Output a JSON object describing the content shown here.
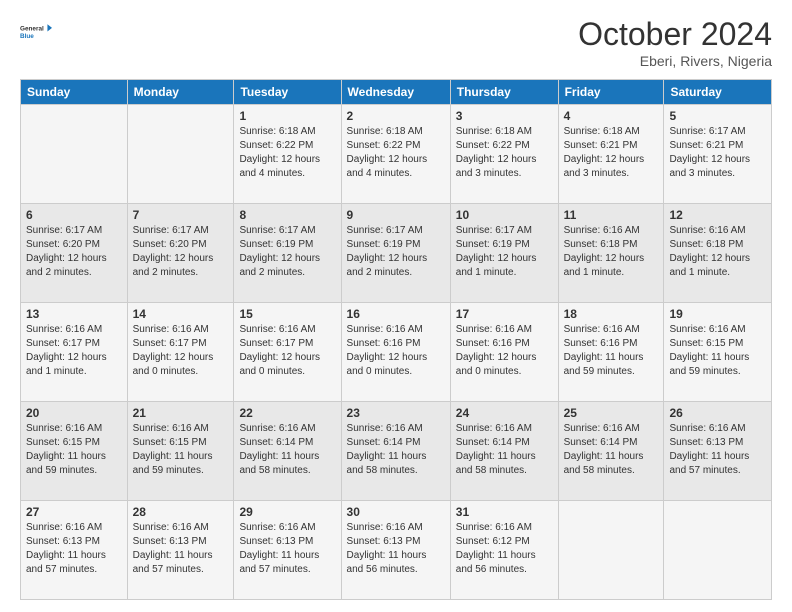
{
  "header": {
    "logo_line1": "General",
    "logo_line2": "Blue",
    "month": "October 2024",
    "location": "Eberi, Rivers, Nigeria"
  },
  "weekdays": [
    "Sunday",
    "Monday",
    "Tuesday",
    "Wednesday",
    "Thursday",
    "Friday",
    "Saturday"
  ],
  "weeks": [
    [
      {
        "day": "",
        "info": ""
      },
      {
        "day": "",
        "info": ""
      },
      {
        "day": "1",
        "info": "Sunrise: 6:18 AM\nSunset: 6:22 PM\nDaylight: 12 hours and 4 minutes."
      },
      {
        "day": "2",
        "info": "Sunrise: 6:18 AM\nSunset: 6:22 PM\nDaylight: 12 hours and 4 minutes."
      },
      {
        "day": "3",
        "info": "Sunrise: 6:18 AM\nSunset: 6:22 PM\nDaylight: 12 hours and 3 minutes."
      },
      {
        "day": "4",
        "info": "Sunrise: 6:18 AM\nSunset: 6:21 PM\nDaylight: 12 hours and 3 minutes."
      },
      {
        "day": "5",
        "info": "Sunrise: 6:17 AM\nSunset: 6:21 PM\nDaylight: 12 hours and 3 minutes."
      }
    ],
    [
      {
        "day": "6",
        "info": "Sunrise: 6:17 AM\nSunset: 6:20 PM\nDaylight: 12 hours and 2 minutes."
      },
      {
        "day": "7",
        "info": "Sunrise: 6:17 AM\nSunset: 6:20 PM\nDaylight: 12 hours and 2 minutes."
      },
      {
        "day": "8",
        "info": "Sunrise: 6:17 AM\nSunset: 6:19 PM\nDaylight: 12 hours and 2 minutes."
      },
      {
        "day": "9",
        "info": "Sunrise: 6:17 AM\nSunset: 6:19 PM\nDaylight: 12 hours and 2 minutes."
      },
      {
        "day": "10",
        "info": "Sunrise: 6:17 AM\nSunset: 6:19 PM\nDaylight: 12 hours and 1 minute."
      },
      {
        "day": "11",
        "info": "Sunrise: 6:16 AM\nSunset: 6:18 PM\nDaylight: 12 hours and 1 minute."
      },
      {
        "day": "12",
        "info": "Sunrise: 6:16 AM\nSunset: 6:18 PM\nDaylight: 12 hours and 1 minute."
      }
    ],
    [
      {
        "day": "13",
        "info": "Sunrise: 6:16 AM\nSunset: 6:17 PM\nDaylight: 12 hours and 1 minute."
      },
      {
        "day": "14",
        "info": "Sunrise: 6:16 AM\nSunset: 6:17 PM\nDaylight: 12 hours and 0 minutes."
      },
      {
        "day": "15",
        "info": "Sunrise: 6:16 AM\nSunset: 6:17 PM\nDaylight: 12 hours and 0 minutes."
      },
      {
        "day": "16",
        "info": "Sunrise: 6:16 AM\nSunset: 6:16 PM\nDaylight: 12 hours and 0 minutes."
      },
      {
        "day": "17",
        "info": "Sunrise: 6:16 AM\nSunset: 6:16 PM\nDaylight: 12 hours and 0 minutes."
      },
      {
        "day": "18",
        "info": "Sunrise: 6:16 AM\nSunset: 6:16 PM\nDaylight: 11 hours and 59 minutes."
      },
      {
        "day": "19",
        "info": "Sunrise: 6:16 AM\nSunset: 6:15 PM\nDaylight: 11 hours and 59 minutes."
      }
    ],
    [
      {
        "day": "20",
        "info": "Sunrise: 6:16 AM\nSunset: 6:15 PM\nDaylight: 11 hours and 59 minutes."
      },
      {
        "day": "21",
        "info": "Sunrise: 6:16 AM\nSunset: 6:15 PM\nDaylight: 11 hours and 59 minutes."
      },
      {
        "day": "22",
        "info": "Sunrise: 6:16 AM\nSunset: 6:14 PM\nDaylight: 11 hours and 58 minutes."
      },
      {
        "day": "23",
        "info": "Sunrise: 6:16 AM\nSunset: 6:14 PM\nDaylight: 11 hours and 58 minutes."
      },
      {
        "day": "24",
        "info": "Sunrise: 6:16 AM\nSunset: 6:14 PM\nDaylight: 11 hours and 58 minutes."
      },
      {
        "day": "25",
        "info": "Sunrise: 6:16 AM\nSunset: 6:14 PM\nDaylight: 11 hours and 58 minutes."
      },
      {
        "day": "26",
        "info": "Sunrise: 6:16 AM\nSunset: 6:13 PM\nDaylight: 11 hours and 57 minutes."
      }
    ],
    [
      {
        "day": "27",
        "info": "Sunrise: 6:16 AM\nSunset: 6:13 PM\nDaylight: 11 hours and 57 minutes."
      },
      {
        "day": "28",
        "info": "Sunrise: 6:16 AM\nSunset: 6:13 PM\nDaylight: 11 hours and 57 minutes."
      },
      {
        "day": "29",
        "info": "Sunrise: 6:16 AM\nSunset: 6:13 PM\nDaylight: 11 hours and 57 minutes."
      },
      {
        "day": "30",
        "info": "Sunrise: 6:16 AM\nSunset: 6:13 PM\nDaylight: 11 hours and 56 minutes."
      },
      {
        "day": "31",
        "info": "Sunrise: 6:16 AM\nSunset: 6:12 PM\nDaylight: 11 hours and 56 minutes."
      },
      {
        "day": "",
        "info": ""
      },
      {
        "day": "",
        "info": ""
      }
    ]
  ]
}
